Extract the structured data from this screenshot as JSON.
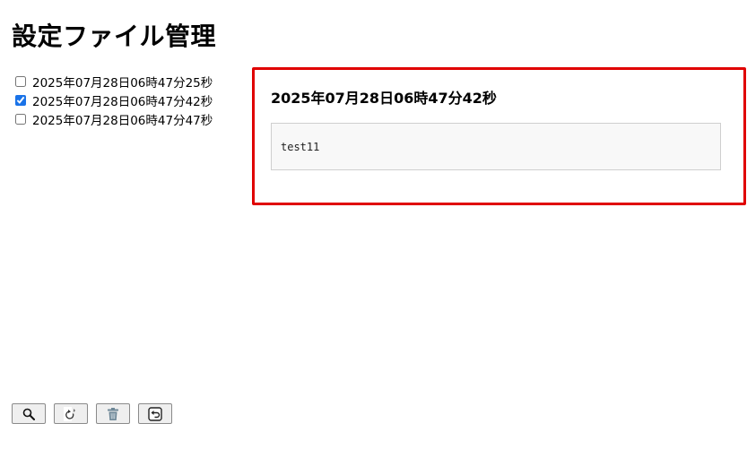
{
  "header": {
    "title": "設定ファイル管理"
  },
  "file_list": {
    "items": [
      {
        "label": "2025年07月28日06時47分25秒",
        "checked": false
      },
      {
        "label": "2025年07月28日06時47分42秒",
        "checked": true
      },
      {
        "label": "2025年07月28日06時47分47秒",
        "checked": false
      }
    ]
  },
  "detail": {
    "title": "2025年07月28日06時47分42秒",
    "content": "test11",
    "border_color": "#e00000"
  },
  "toolbar": {
    "buttons": [
      {
        "icon": "search-icon"
      },
      {
        "icon": "refresh-icon"
      },
      {
        "icon": "trash-icon"
      },
      {
        "icon": "return-icon"
      }
    ]
  }
}
